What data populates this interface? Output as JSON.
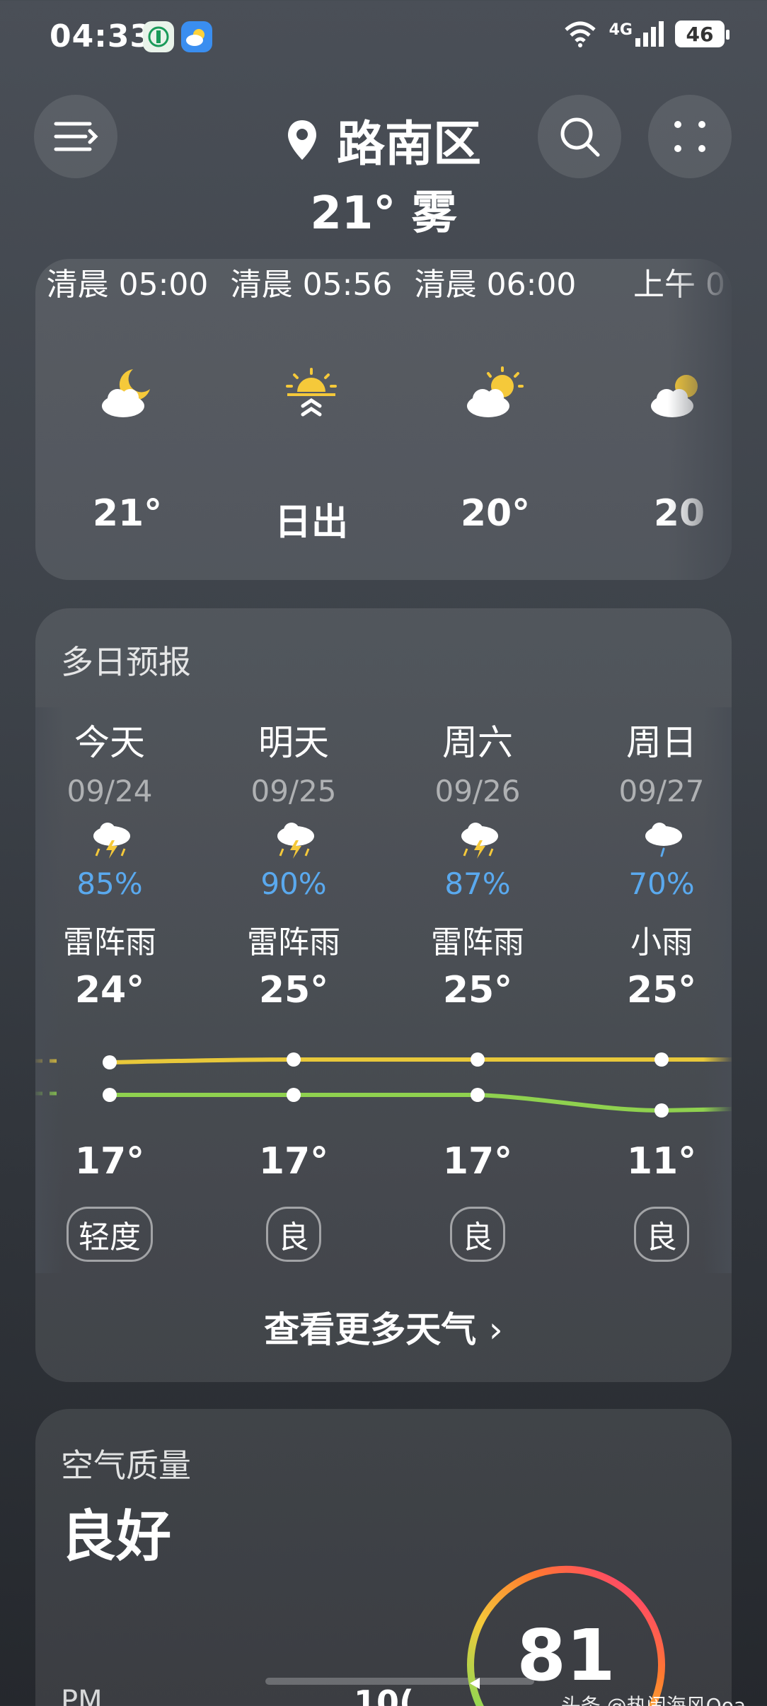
{
  "status": {
    "time": "04:33",
    "network": "4G",
    "battery": "46"
  },
  "header": {
    "location": "路南区",
    "current": "21° 雾"
  },
  "hourly": [
    {
      "time": "清晨 05:00",
      "icon": "moon-cloud-icon",
      "value": "21°"
    },
    {
      "time": "清晨 05:56",
      "icon": "sunrise-icon",
      "value": "日出"
    },
    {
      "time": "清晨 06:00",
      "icon": "sun-cloud-icon",
      "value": "20°"
    },
    {
      "time": "上午 0",
      "icon": "sun-cloud-icon",
      "value": "20"
    }
  ],
  "daily": {
    "title": "多日预报",
    "days": [
      {
        "name": "今天",
        "date": "09/24",
        "icon": "thunderstorm-icon",
        "precip": "85%",
        "cond": "雷阵雨",
        "high": "24°",
        "low": "17°",
        "aqi": "轻度"
      },
      {
        "name": "明天",
        "date": "09/25",
        "icon": "thunderstorm-icon",
        "precip": "90%",
        "cond": "雷阵雨",
        "high": "25°",
        "low": "17°",
        "aqi": "良"
      },
      {
        "name": "周六",
        "date": "09/26",
        "icon": "thunderstorm-icon",
        "precip": "87%",
        "cond": "雷阵雨",
        "high": "25°",
        "low": "17°",
        "aqi": "良"
      },
      {
        "name": "周日",
        "date": "09/27",
        "icon": "rain-icon",
        "precip": "70%",
        "cond": "小雨",
        "high": "25°",
        "low": "11°",
        "aqi": "良"
      }
    ],
    "more": "查看更多天气",
    "high_color": "#e8c83a",
    "low_color": "#8fd14f"
  },
  "air": {
    "title": "空气质量",
    "level": "良好",
    "aqi": "81",
    "pm_label": "PM",
    "pm_value": "10("
  },
  "watermark": "头条 @热闹海风Ooa"
}
